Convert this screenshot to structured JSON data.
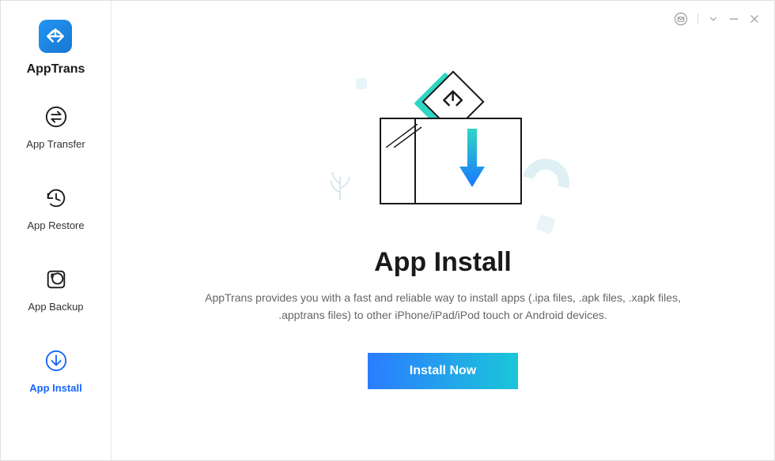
{
  "app": {
    "name": "AppTrans"
  },
  "sidebar": {
    "items": [
      {
        "label": "App Transfer",
        "icon": "transfer-icon"
      },
      {
        "label": "App Restore",
        "icon": "restore-icon"
      },
      {
        "label": "App Backup",
        "icon": "backup-icon"
      },
      {
        "label": "App Install",
        "icon": "install-icon"
      }
    ]
  },
  "main": {
    "title": "App Install",
    "description": "AppTrans provides you with a fast and reliable way to install apps (.ipa files, .apk files, .xapk files, .apptrans files) to other iPhone/iPad/iPod touch or Android devices.",
    "button": "Install Now"
  },
  "colors": {
    "accent": "#1565ff",
    "gradient_start": "#2b7cff",
    "gradient_end": "#1bc6d9"
  }
}
